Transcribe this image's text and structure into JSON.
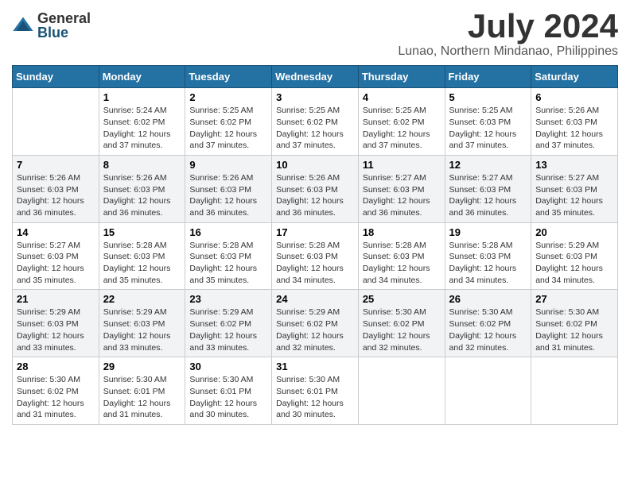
{
  "header": {
    "logo_general": "General",
    "logo_blue": "Blue",
    "month_title": "July 2024",
    "location": "Lunao, Northern Mindanao, Philippines"
  },
  "days_of_week": [
    "Sunday",
    "Monday",
    "Tuesday",
    "Wednesday",
    "Thursday",
    "Friday",
    "Saturday"
  ],
  "weeks": [
    [
      {
        "day": "",
        "sunrise": "",
        "sunset": "",
        "daylight": ""
      },
      {
        "day": "1",
        "sunrise": "Sunrise: 5:24 AM",
        "sunset": "Sunset: 6:02 PM",
        "daylight": "Daylight: 12 hours and 37 minutes."
      },
      {
        "day": "2",
        "sunrise": "Sunrise: 5:25 AM",
        "sunset": "Sunset: 6:02 PM",
        "daylight": "Daylight: 12 hours and 37 minutes."
      },
      {
        "day": "3",
        "sunrise": "Sunrise: 5:25 AM",
        "sunset": "Sunset: 6:02 PM",
        "daylight": "Daylight: 12 hours and 37 minutes."
      },
      {
        "day": "4",
        "sunrise": "Sunrise: 5:25 AM",
        "sunset": "Sunset: 6:02 PM",
        "daylight": "Daylight: 12 hours and 37 minutes."
      },
      {
        "day": "5",
        "sunrise": "Sunrise: 5:25 AM",
        "sunset": "Sunset: 6:03 PM",
        "daylight": "Daylight: 12 hours and 37 minutes."
      },
      {
        "day": "6",
        "sunrise": "Sunrise: 5:26 AM",
        "sunset": "Sunset: 6:03 PM",
        "daylight": "Daylight: 12 hours and 37 minutes."
      }
    ],
    [
      {
        "day": "7",
        "sunrise": "Sunrise: 5:26 AM",
        "sunset": "Sunset: 6:03 PM",
        "daylight": "Daylight: 12 hours and 36 minutes."
      },
      {
        "day": "8",
        "sunrise": "Sunrise: 5:26 AM",
        "sunset": "Sunset: 6:03 PM",
        "daylight": "Daylight: 12 hours and 36 minutes."
      },
      {
        "day": "9",
        "sunrise": "Sunrise: 5:26 AM",
        "sunset": "Sunset: 6:03 PM",
        "daylight": "Daylight: 12 hours and 36 minutes."
      },
      {
        "day": "10",
        "sunrise": "Sunrise: 5:26 AM",
        "sunset": "Sunset: 6:03 PM",
        "daylight": "Daylight: 12 hours and 36 minutes."
      },
      {
        "day": "11",
        "sunrise": "Sunrise: 5:27 AM",
        "sunset": "Sunset: 6:03 PM",
        "daylight": "Daylight: 12 hours and 36 minutes."
      },
      {
        "day": "12",
        "sunrise": "Sunrise: 5:27 AM",
        "sunset": "Sunset: 6:03 PM",
        "daylight": "Daylight: 12 hours and 36 minutes."
      },
      {
        "day": "13",
        "sunrise": "Sunrise: 5:27 AM",
        "sunset": "Sunset: 6:03 PM",
        "daylight": "Daylight: 12 hours and 35 minutes."
      }
    ],
    [
      {
        "day": "14",
        "sunrise": "Sunrise: 5:27 AM",
        "sunset": "Sunset: 6:03 PM",
        "daylight": "Daylight: 12 hours and 35 minutes."
      },
      {
        "day": "15",
        "sunrise": "Sunrise: 5:28 AM",
        "sunset": "Sunset: 6:03 PM",
        "daylight": "Daylight: 12 hours and 35 minutes."
      },
      {
        "day": "16",
        "sunrise": "Sunrise: 5:28 AM",
        "sunset": "Sunset: 6:03 PM",
        "daylight": "Daylight: 12 hours and 35 minutes."
      },
      {
        "day": "17",
        "sunrise": "Sunrise: 5:28 AM",
        "sunset": "Sunset: 6:03 PM",
        "daylight": "Daylight: 12 hours and 34 minutes."
      },
      {
        "day": "18",
        "sunrise": "Sunrise: 5:28 AM",
        "sunset": "Sunset: 6:03 PM",
        "daylight": "Daylight: 12 hours and 34 minutes."
      },
      {
        "day": "19",
        "sunrise": "Sunrise: 5:28 AM",
        "sunset": "Sunset: 6:03 PM",
        "daylight": "Daylight: 12 hours and 34 minutes."
      },
      {
        "day": "20",
        "sunrise": "Sunrise: 5:29 AM",
        "sunset": "Sunset: 6:03 PM",
        "daylight": "Daylight: 12 hours and 34 minutes."
      }
    ],
    [
      {
        "day": "21",
        "sunrise": "Sunrise: 5:29 AM",
        "sunset": "Sunset: 6:03 PM",
        "daylight": "Daylight: 12 hours and 33 minutes."
      },
      {
        "day": "22",
        "sunrise": "Sunrise: 5:29 AM",
        "sunset": "Sunset: 6:03 PM",
        "daylight": "Daylight: 12 hours and 33 minutes."
      },
      {
        "day": "23",
        "sunrise": "Sunrise: 5:29 AM",
        "sunset": "Sunset: 6:02 PM",
        "daylight": "Daylight: 12 hours and 33 minutes."
      },
      {
        "day": "24",
        "sunrise": "Sunrise: 5:29 AM",
        "sunset": "Sunset: 6:02 PM",
        "daylight": "Daylight: 12 hours and 32 minutes."
      },
      {
        "day": "25",
        "sunrise": "Sunrise: 5:30 AM",
        "sunset": "Sunset: 6:02 PM",
        "daylight": "Daylight: 12 hours and 32 minutes."
      },
      {
        "day": "26",
        "sunrise": "Sunrise: 5:30 AM",
        "sunset": "Sunset: 6:02 PM",
        "daylight": "Daylight: 12 hours and 32 minutes."
      },
      {
        "day": "27",
        "sunrise": "Sunrise: 5:30 AM",
        "sunset": "Sunset: 6:02 PM",
        "daylight": "Daylight: 12 hours and 31 minutes."
      }
    ],
    [
      {
        "day": "28",
        "sunrise": "Sunrise: 5:30 AM",
        "sunset": "Sunset: 6:02 PM",
        "daylight": "Daylight: 12 hours and 31 minutes."
      },
      {
        "day": "29",
        "sunrise": "Sunrise: 5:30 AM",
        "sunset": "Sunset: 6:01 PM",
        "daylight": "Daylight: 12 hours and 31 minutes."
      },
      {
        "day": "30",
        "sunrise": "Sunrise: 5:30 AM",
        "sunset": "Sunset: 6:01 PM",
        "daylight": "Daylight: 12 hours and 30 minutes."
      },
      {
        "day": "31",
        "sunrise": "Sunrise: 5:30 AM",
        "sunset": "Sunset: 6:01 PM",
        "daylight": "Daylight: 12 hours and 30 minutes."
      },
      {
        "day": "",
        "sunrise": "",
        "sunset": "",
        "daylight": ""
      },
      {
        "day": "",
        "sunrise": "",
        "sunset": "",
        "daylight": ""
      },
      {
        "day": "",
        "sunrise": "",
        "sunset": "",
        "daylight": ""
      }
    ]
  ]
}
